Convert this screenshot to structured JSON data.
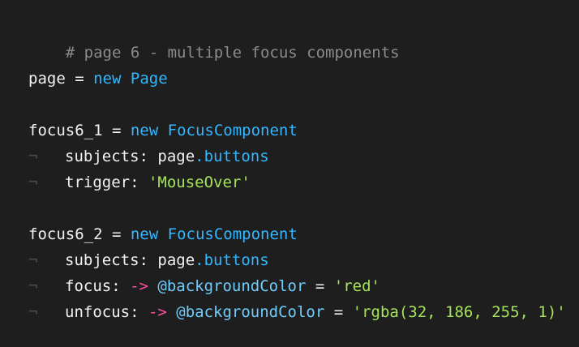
{
  "code": {
    "comment": "# page 6 - multiple focus components",
    "l_page": {
      "var": "page",
      "eq": " = ",
      "kw": "new",
      "sp": " ",
      "cls": "Page"
    },
    "l_f1": {
      "var": "focus6_1",
      "eq": " = ",
      "kw": "new",
      "sp": " ",
      "cls": "FocusComponent"
    },
    "l_f1_subjects": {
      "ws": "¬",
      "key": "subjects: ",
      "obj": "page",
      "prop": ".buttons"
    },
    "l_f1_trigger": {
      "ws": "¬",
      "key": "trigger: ",
      "str": "'MouseOver'"
    },
    "l_f2": {
      "var": "focus6_2",
      "eq": " = ",
      "kw": "new",
      "sp": " ",
      "cls": "FocusComponent"
    },
    "l_f2_subjects": {
      "ws": "¬",
      "key": "subjects: ",
      "obj": "page",
      "prop": ".buttons"
    },
    "l_f2_focus": {
      "ws": "¬",
      "key": "focus: ",
      "arrow": "->",
      "ivar": " @backgroundColor",
      "eq": " = ",
      "str": "'red'"
    },
    "l_f2_unfocus": {
      "ws": "¬",
      "key": "unfocus: ",
      "arrow": "->",
      "ivar": " @backgroundColor",
      "eq": " = ",
      "str": "'rgba(32, 186, 255, 1)'"
    }
  },
  "colors": {
    "background": "#1e1e1e",
    "text": "#f2f2f2",
    "comment": "#8b8b8b",
    "keyword": "#33b7ff",
    "string": "#a5e35a",
    "arrow": "#ff4fa3",
    "instance_var": "#6fcdfc",
    "whitespace_marker": "#4a4a4a"
  }
}
